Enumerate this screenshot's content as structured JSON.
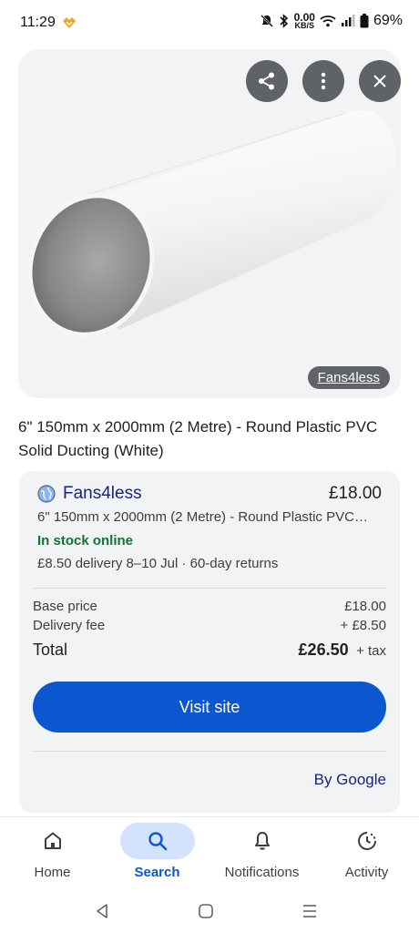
{
  "status_bar": {
    "time": "11:29",
    "speed_value": "0.00",
    "speed_unit": "KB/S",
    "battery": "69%"
  },
  "image_card": {
    "source_label": "Fans4less",
    "buttons": [
      "share-icon",
      "more-vert-icon",
      "close-icon"
    ]
  },
  "product": {
    "title": "6\" 150mm x 2000mm (2 Metre) - Round Plastic PVC Solid Ducting (White)"
  },
  "offer": {
    "seller": "Fans4less",
    "price": "£18.00",
    "description": "6\" 150mm x 2000mm (2 Metre) - Round Plastic PVC…",
    "stock": "In stock online",
    "delivery": "£8.50 delivery 8–10 Jul · 60-day returns",
    "base_price_label": "Base price",
    "base_price_value": "£18.00",
    "delivery_fee_label": "Delivery fee",
    "delivery_fee_value": "+ £8.50",
    "total_label": "Total",
    "total_value": "£26.50",
    "tax_label": "+ tax",
    "visit_label": "Visit site",
    "by_label": "By Google"
  },
  "bottom_nav": {
    "items": [
      {
        "label": "Home",
        "icon": "home-icon",
        "active": false
      },
      {
        "label": "Search",
        "icon": "search-icon",
        "active": true
      },
      {
        "label": "Notifications",
        "icon": "bell-icon",
        "active": false
      },
      {
        "label": "Activity",
        "icon": "activity-icon",
        "active": false
      }
    ]
  },
  "colors": {
    "accent": "#0b57d0",
    "active_pill": "#d3e3fd",
    "stock_green": "#137333",
    "seller_blue": "#1a237e",
    "card_bg": "#f1f3f4"
  }
}
